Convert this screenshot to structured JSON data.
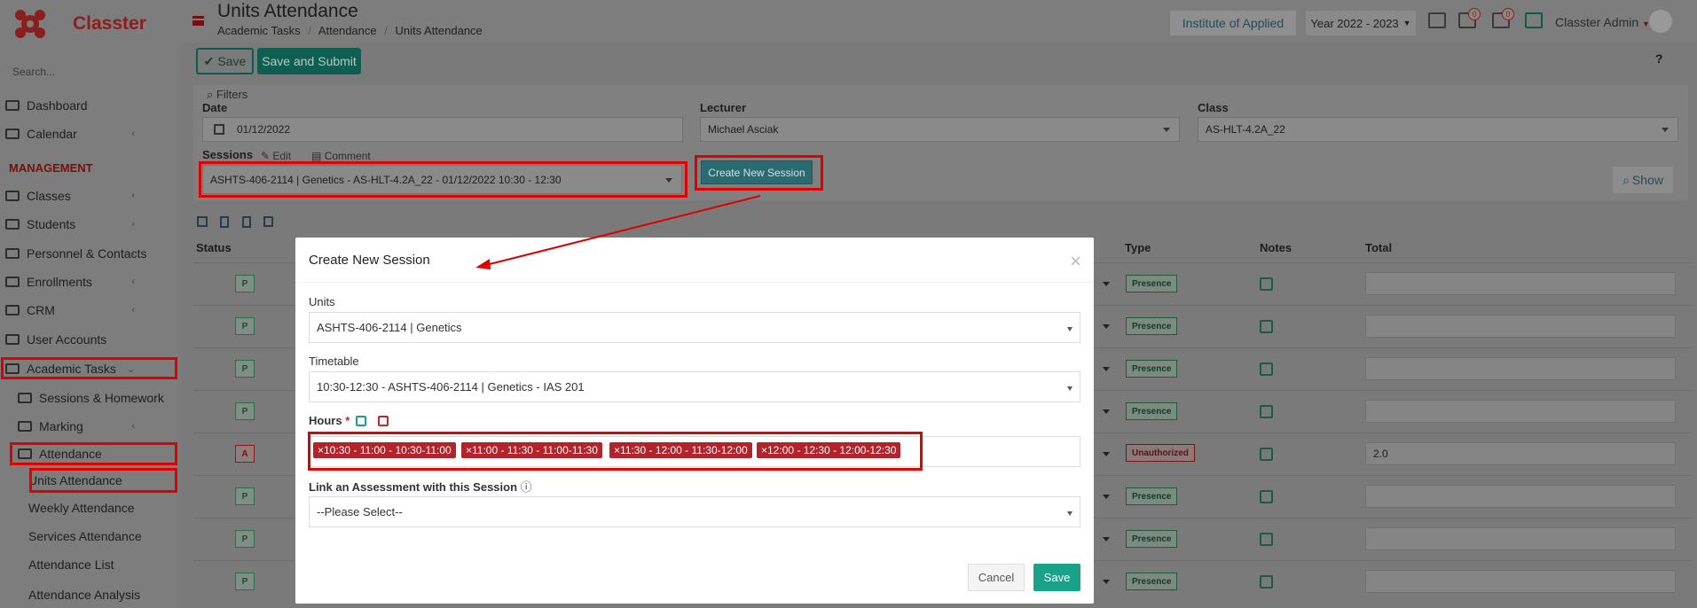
{
  "app": {
    "name": "Classter",
    "search_placeholder": "Search..."
  },
  "sidebar": {
    "section_title": "MANAGEMENT",
    "items": [
      {
        "label": "Dashboard"
      },
      {
        "label": "Calendar"
      },
      {
        "label": "Classes"
      },
      {
        "label": "Students"
      },
      {
        "label": "Personnel & Contacts"
      },
      {
        "label": "Enrollments"
      },
      {
        "label": "CRM"
      },
      {
        "label": "User Accounts"
      },
      {
        "label": "Academic Tasks"
      },
      {
        "label": "Sessions & Homework"
      },
      {
        "label": "Marking"
      },
      {
        "label": "Attendance"
      },
      {
        "label": "Units Attendance"
      },
      {
        "label": "Weekly Attendance"
      },
      {
        "label": "Services Attendance"
      },
      {
        "label": "Attendance List"
      },
      {
        "label": "Attendance Analysis"
      }
    ]
  },
  "header": {
    "title": "Units Attendance",
    "breadcrumb": [
      "Academic Tasks",
      "Attendance",
      "Units Attendance"
    ],
    "institute": "Institute of Applied",
    "year": "Year 2022 - 2023",
    "notifications": "0",
    "messages": "0",
    "user": "Classter Admin"
  },
  "toolbar": {
    "save": "Save",
    "save_submit": "Save and Submit",
    "help": "?"
  },
  "filters": {
    "title": "Filters",
    "date_label": "Date",
    "date_value": "01/12/2022",
    "lecturer_label": "Lecturer",
    "lecturer_value": "Michael Asciak",
    "class_label": "Class",
    "class_value": "AS-HLT-4.2A_22",
    "sessions_label": "Sessions",
    "edit": "Edit",
    "comment": "Comment",
    "session_value": "ASHTS-406-2114 | Genetics - AS-HLT-4.2A_22 - 01/12/2022 10:30 - 12:30",
    "create_session": "Create New Session",
    "show": "Show"
  },
  "table": {
    "headers": [
      "Status",
      "Type",
      "Notes",
      "Total"
    ],
    "rows": [
      {
        "status": "P",
        "type": "Presence",
        "total": ""
      },
      {
        "status": "P",
        "type": "Presence",
        "total": ""
      },
      {
        "status": "P",
        "type": "Presence",
        "total": ""
      },
      {
        "status": "P",
        "type": "Presence",
        "total": ""
      },
      {
        "status": "A",
        "type": "Unauthorized",
        "total": "2.0"
      },
      {
        "status": "P",
        "type": "Presence",
        "total": ""
      },
      {
        "status": "P",
        "type": "Presence",
        "total": ""
      },
      {
        "status": "P",
        "type": "Presence",
        "total": ""
      }
    ]
  },
  "modal": {
    "title": "Create New Session",
    "units_label": "Units",
    "units_value": "ASHTS-406-2114 | Genetics",
    "timetable_label": "Timetable",
    "timetable_value": "10:30-12:30 - ASHTS-406-2114 | Genetics - IAS 201",
    "hours_label": "Hours",
    "hours_required": "*",
    "hours": [
      "×10:30 - 11:00 - 10:30-11:00",
      "×11:00 - 11:30 - 11:00-11:30",
      "×11:30 - 12:00 - 11:30-12:00",
      "×12:00 - 12:30 - 12:00-12:30"
    ],
    "assessment_label": "Link an Assessment with this Session",
    "assessment_value": "--Please Select--",
    "cancel": "Cancel",
    "save": "Save"
  },
  "colors": {
    "brand": "#8a1f1f",
    "accent": "#1aa289",
    "chip": "#b3232b",
    "highlight": "#e00000"
  }
}
